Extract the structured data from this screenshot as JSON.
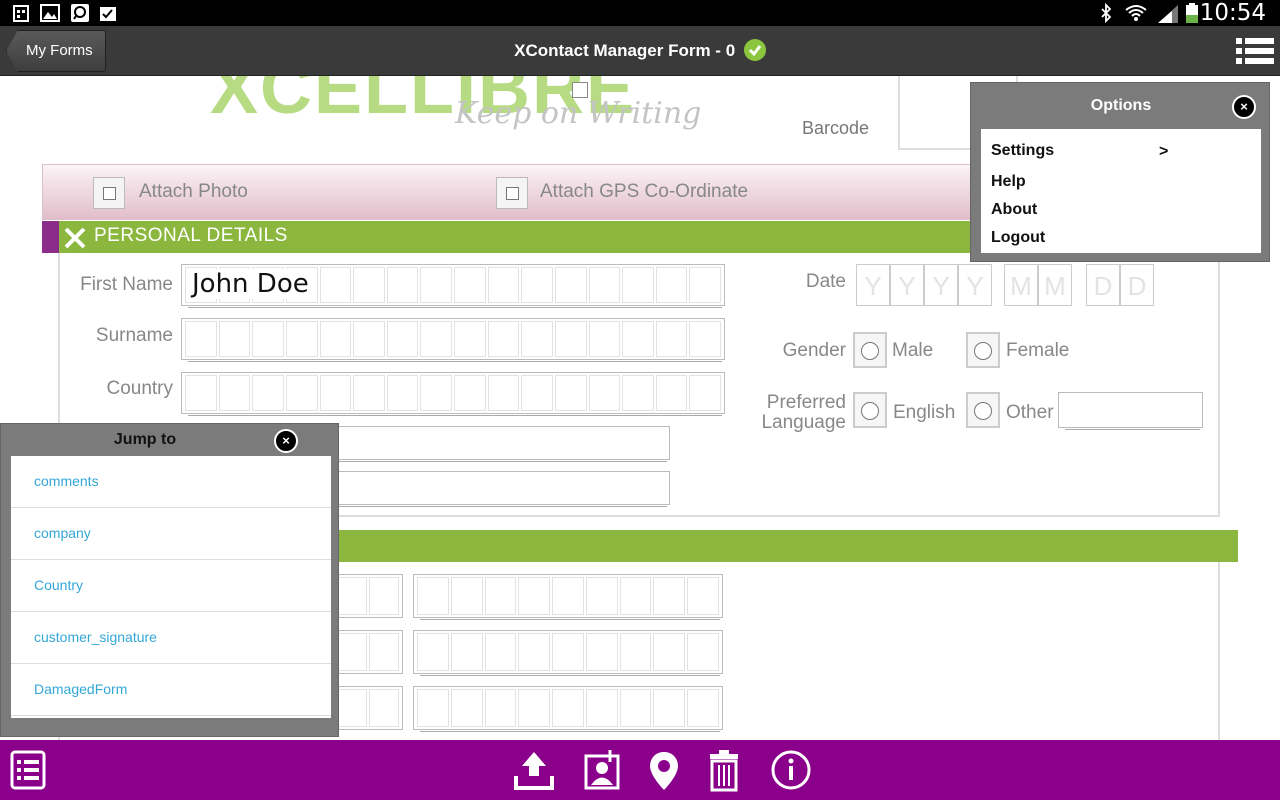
{
  "status_bar": {
    "time": "10:54"
  },
  "action_bar": {
    "back_label": "My Forms",
    "title": "XContact Manager Form - 0"
  },
  "form": {
    "logo_text": "XCELLIBRE",
    "tagline": "Keep on Writing",
    "barcode_label": "Barcode",
    "attach_photo": "Attach Photo",
    "attach_gps": "Attach GPS Co-Ordinate",
    "section_personal": "PERSONAL DETAILS",
    "first_name_label": "First Name",
    "first_name_value": "John Doe",
    "surname_label": "Surname",
    "country_label": "Country",
    "date_label": "Date",
    "date_placeholders": [
      "Y",
      "Y",
      "Y",
      "Y",
      "M",
      "M",
      "D",
      "D"
    ],
    "gender_label": "Gender",
    "gender_male": "Male",
    "gender_female": "Female",
    "pref_lang_label_1": "Preferred",
    "pref_lang_label_2": "Language",
    "lang_english": "English",
    "lang_other": "Other"
  },
  "options_menu": {
    "title": "Options",
    "close": "×",
    "items": [
      "Settings",
      "Help",
      "About",
      "Logout"
    ],
    "settings_arrow": ">"
  },
  "jump_to": {
    "title": "Jump to",
    "close": "×",
    "items": [
      "comments",
      "company",
      "Country",
      "customer_signature",
      "DamagedForm"
    ]
  },
  "bottom_bar": {
    "icons": [
      "list-icon",
      "upload-icon",
      "attach-contact-icon",
      "location-pin-icon",
      "trash-icon",
      "info-icon"
    ]
  },
  "colors": {
    "brand_green": "#8bb73f",
    "brand_purple": "#8b008b",
    "link_blue": "#33a7d6"
  }
}
